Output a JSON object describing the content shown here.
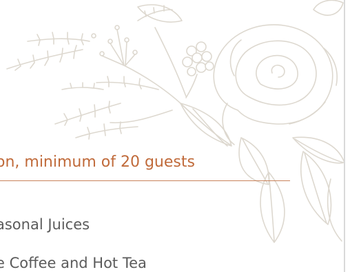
{
  "section": {
    "heading": "on, minimum of 20 guests"
  },
  "menu_items": [
    {
      "label": "asonal Juices"
    },
    {
      "label": "e Coffee and Hot Tea"
    }
  ],
  "decoration": {
    "artwork": "floral-line-drawing",
    "line_color": "#ddd8cf",
    "heading_color": "#c06a3a",
    "text_color": "#5b5b5b"
  }
}
